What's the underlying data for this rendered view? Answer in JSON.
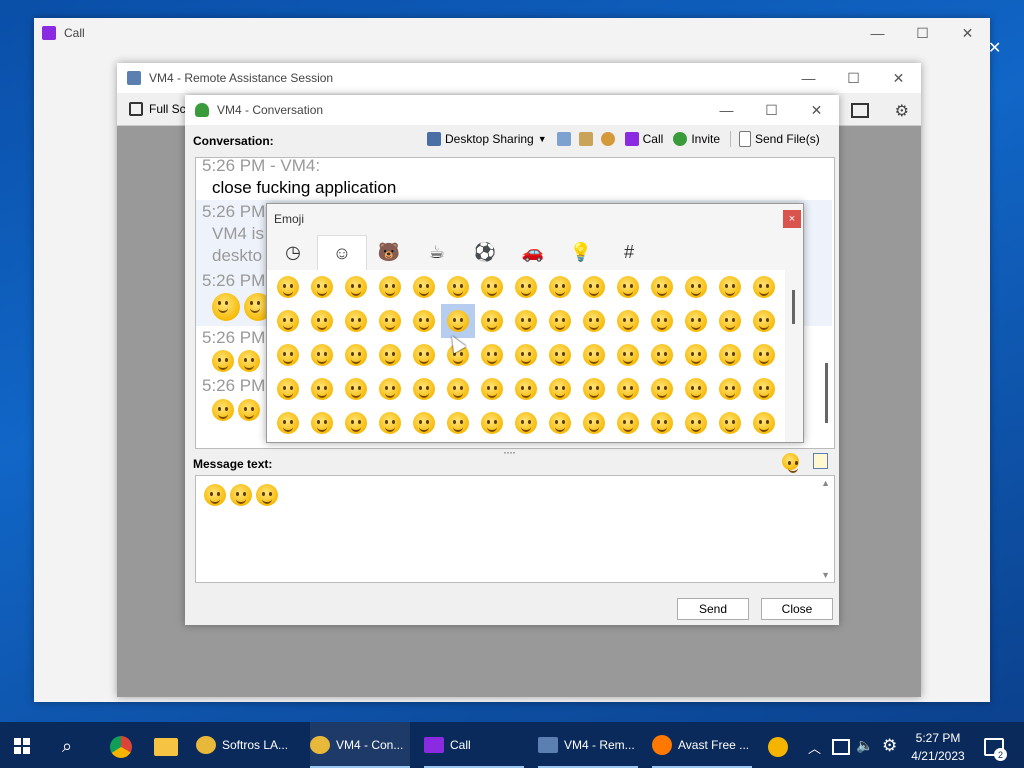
{
  "call_window": {
    "title": "Call"
  },
  "ra_window": {
    "title": "VM4 - Remote Assistance Session",
    "full_screen_label": "Full Sc"
  },
  "conv_window": {
    "title": "VM4 - Conversation",
    "conversation_label": "Conversation:",
    "toolbar": {
      "desktop_sharing": "Desktop Sharing",
      "call": "Call",
      "invite": "Invite",
      "send_files": "Send File(s)"
    },
    "messages": [
      {
        "header": "5:26 PM - VM4:",
        "text": "close fucking application"
      },
      {
        "header": "5:26 PM",
        "text": "VM4 is"
      },
      {
        "header": "",
        "text": "deskto"
      },
      {
        "header": "5:26 PM",
        "text": ""
      },
      {
        "header": "5:26 PM",
        "text": ""
      },
      {
        "header": "5:26 PM",
        "text": ""
      }
    ],
    "message_text_label": "Message text:",
    "send_label": "Send",
    "close_label": "Close",
    "emoji_count_in_message": 3
  },
  "emoji_popup": {
    "title": "Emoji",
    "close_glyph": "×",
    "tabs": [
      "recent-icon",
      "smiley-icon",
      "animal-icon",
      "food-icon",
      "sports-icon",
      "car-icon",
      "lightbulb-icon",
      "symbol-icon"
    ],
    "tab_glyphs": [
      "◷",
      "☺",
      "🐻",
      "☕",
      "⚽",
      "🚗",
      "💡",
      "#"
    ],
    "rows": 5,
    "cols": 15,
    "selected_row": 2,
    "selected_col": 6
  },
  "taskbar": {
    "items": [
      {
        "label": "Softros LA..."
      },
      {
        "label": "VM4 - Con..."
      },
      {
        "label": "Call"
      },
      {
        "label": "VM4 - Rem..."
      },
      {
        "label": "Avast Free ..."
      }
    ],
    "time": "5:27 PM",
    "date": "4/21/2023",
    "notification_count": "2"
  },
  "colors": {
    "accent": "#0067c0",
    "close_red": "#d9534f",
    "taskbar": "#0b2a5c"
  }
}
